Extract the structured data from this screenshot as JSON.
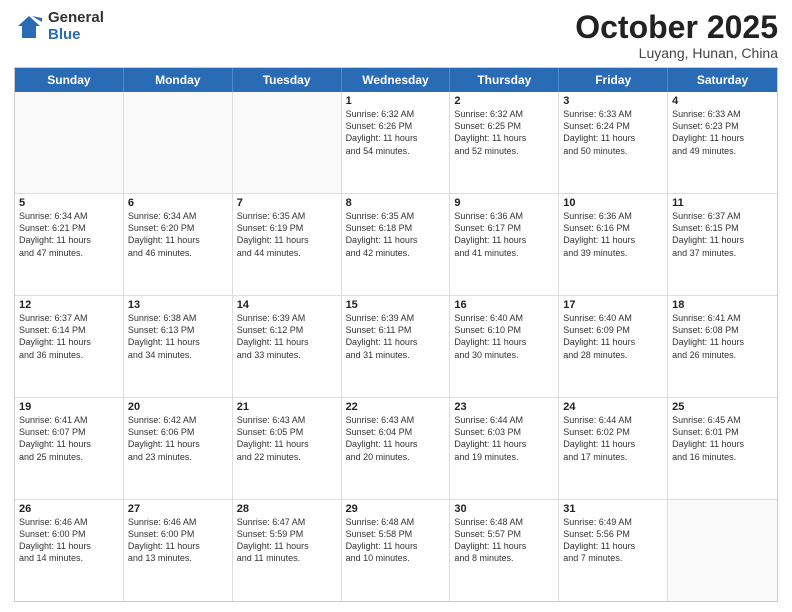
{
  "logo": {
    "general": "General",
    "blue": "Blue"
  },
  "title": {
    "month": "October 2025",
    "location": "Luyang, Hunan, China"
  },
  "header_days": [
    "Sunday",
    "Monday",
    "Tuesday",
    "Wednesday",
    "Thursday",
    "Friday",
    "Saturday"
  ],
  "weeks": [
    [
      {
        "day": "",
        "text": ""
      },
      {
        "day": "",
        "text": ""
      },
      {
        "day": "",
        "text": ""
      },
      {
        "day": "1",
        "text": "Sunrise: 6:32 AM\nSunset: 6:26 PM\nDaylight: 11 hours\nand 54 minutes."
      },
      {
        "day": "2",
        "text": "Sunrise: 6:32 AM\nSunset: 6:25 PM\nDaylight: 11 hours\nand 52 minutes."
      },
      {
        "day": "3",
        "text": "Sunrise: 6:33 AM\nSunset: 6:24 PM\nDaylight: 11 hours\nand 50 minutes."
      },
      {
        "day": "4",
        "text": "Sunrise: 6:33 AM\nSunset: 6:23 PM\nDaylight: 11 hours\nand 49 minutes."
      }
    ],
    [
      {
        "day": "5",
        "text": "Sunrise: 6:34 AM\nSunset: 6:21 PM\nDaylight: 11 hours\nand 47 minutes."
      },
      {
        "day": "6",
        "text": "Sunrise: 6:34 AM\nSunset: 6:20 PM\nDaylight: 11 hours\nand 46 minutes."
      },
      {
        "day": "7",
        "text": "Sunrise: 6:35 AM\nSunset: 6:19 PM\nDaylight: 11 hours\nand 44 minutes."
      },
      {
        "day": "8",
        "text": "Sunrise: 6:35 AM\nSunset: 6:18 PM\nDaylight: 11 hours\nand 42 minutes."
      },
      {
        "day": "9",
        "text": "Sunrise: 6:36 AM\nSunset: 6:17 PM\nDaylight: 11 hours\nand 41 minutes."
      },
      {
        "day": "10",
        "text": "Sunrise: 6:36 AM\nSunset: 6:16 PM\nDaylight: 11 hours\nand 39 minutes."
      },
      {
        "day": "11",
        "text": "Sunrise: 6:37 AM\nSunset: 6:15 PM\nDaylight: 11 hours\nand 37 minutes."
      }
    ],
    [
      {
        "day": "12",
        "text": "Sunrise: 6:37 AM\nSunset: 6:14 PM\nDaylight: 11 hours\nand 36 minutes."
      },
      {
        "day": "13",
        "text": "Sunrise: 6:38 AM\nSunset: 6:13 PM\nDaylight: 11 hours\nand 34 minutes."
      },
      {
        "day": "14",
        "text": "Sunrise: 6:39 AM\nSunset: 6:12 PM\nDaylight: 11 hours\nand 33 minutes."
      },
      {
        "day": "15",
        "text": "Sunrise: 6:39 AM\nSunset: 6:11 PM\nDaylight: 11 hours\nand 31 minutes."
      },
      {
        "day": "16",
        "text": "Sunrise: 6:40 AM\nSunset: 6:10 PM\nDaylight: 11 hours\nand 30 minutes."
      },
      {
        "day": "17",
        "text": "Sunrise: 6:40 AM\nSunset: 6:09 PM\nDaylight: 11 hours\nand 28 minutes."
      },
      {
        "day": "18",
        "text": "Sunrise: 6:41 AM\nSunset: 6:08 PM\nDaylight: 11 hours\nand 26 minutes."
      }
    ],
    [
      {
        "day": "19",
        "text": "Sunrise: 6:41 AM\nSunset: 6:07 PM\nDaylight: 11 hours\nand 25 minutes."
      },
      {
        "day": "20",
        "text": "Sunrise: 6:42 AM\nSunset: 6:06 PM\nDaylight: 11 hours\nand 23 minutes."
      },
      {
        "day": "21",
        "text": "Sunrise: 6:43 AM\nSunset: 6:05 PM\nDaylight: 11 hours\nand 22 minutes."
      },
      {
        "day": "22",
        "text": "Sunrise: 6:43 AM\nSunset: 6:04 PM\nDaylight: 11 hours\nand 20 minutes."
      },
      {
        "day": "23",
        "text": "Sunrise: 6:44 AM\nSunset: 6:03 PM\nDaylight: 11 hours\nand 19 minutes."
      },
      {
        "day": "24",
        "text": "Sunrise: 6:44 AM\nSunset: 6:02 PM\nDaylight: 11 hours\nand 17 minutes."
      },
      {
        "day": "25",
        "text": "Sunrise: 6:45 AM\nSunset: 6:01 PM\nDaylight: 11 hours\nand 16 minutes."
      }
    ],
    [
      {
        "day": "26",
        "text": "Sunrise: 6:46 AM\nSunset: 6:00 PM\nDaylight: 11 hours\nand 14 minutes."
      },
      {
        "day": "27",
        "text": "Sunrise: 6:46 AM\nSunset: 6:00 PM\nDaylight: 11 hours\nand 13 minutes."
      },
      {
        "day": "28",
        "text": "Sunrise: 6:47 AM\nSunset: 5:59 PM\nDaylight: 11 hours\nand 11 minutes."
      },
      {
        "day": "29",
        "text": "Sunrise: 6:48 AM\nSunset: 5:58 PM\nDaylight: 11 hours\nand 10 minutes."
      },
      {
        "day": "30",
        "text": "Sunrise: 6:48 AM\nSunset: 5:57 PM\nDaylight: 11 hours\nand 8 minutes."
      },
      {
        "day": "31",
        "text": "Sunrise: 6:49 AM\nSunset: 5:56 PM\nDaylight: 11 hours\nand 7 minutes."
      },
      {
        "day": "",
        "text": ""
      }
    ]
  ]
}
